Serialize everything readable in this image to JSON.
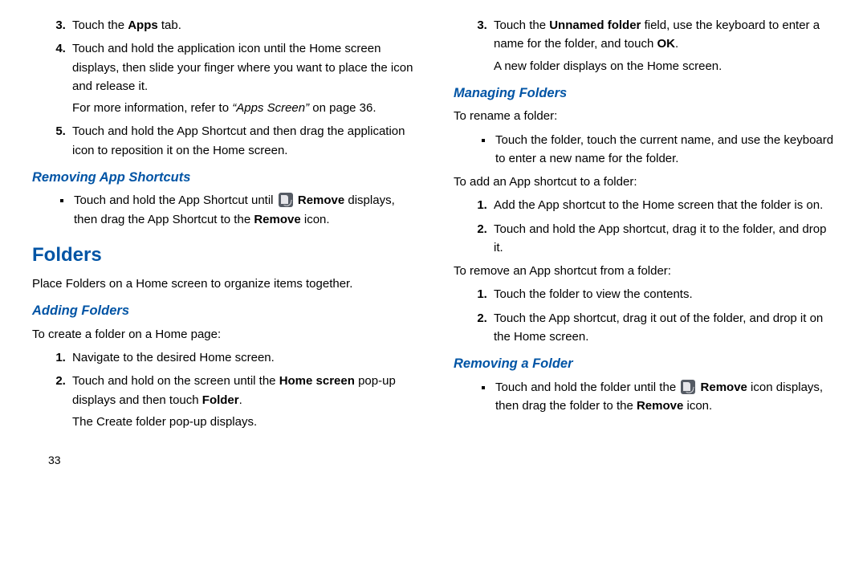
{
  "col1": {
    "steps_top": [
      {
        "num": "3.",
        "html": "Touch the <b>Apps</b> tab."
      },
      {
        "num": "4.",
        "html": "Touch and hold the application icon until the Home screen displays, then slide your finger where you want to place the icon and release it.",
        "after": "For more information, refer to <i>“Apps Screen”</i> on page 36."
      },
      {
        "num": "5.",
        "html": "Touch and hold the App Shortcut and then drag the application icon to reposition it on the Home screen."
      }
    ],
    "removing_shortcuts": {
      "title": "Removing App Shortcuts",
      "bullet": "Touch and hold the App Shortcut until [ICON] <b>Remove</b> displays, then drag the App Shortcut to the <b>Remove</b> icon."
    },
    "folders": {
      "title": "Folders",
      "intro": "Place Folders on a Home screen to organize items together."
    },
    "adding": {
      "title": "Adding Folders",
      "intro": "To create a folder on a Home page:",
      "steps": [
        {
          "num": "1.",
          "html": "Navigate to the desired Home screen."
        },
        {
          "num": "2.",
          "html": "Touch and hold on the screen until the <b>Home screen</b> pop-up displays and then touch <b>Folder</b>.",
          "after": "The Create folder pop-up displays."
        }
      ]
    }
  },
  "col2": {
    "step3": {
      "num": "3.",
      "html": "Touch the <b>Unnamed folder</b> field, use the keyboard to enter a name for the folder, and touch <b>OK</b>.",
      "after": "A new folder displays on the Home screen."
    },
    "managing": {
      "title": "Managing Folders",
      "rename_intro": "To rename a folder:",
      "rename_bullet": "Touch the folder, touch the current name, and use the keyboard to enter a new name for the folder.",
      "add_intro": "To add an App shortcut to a folder:",
      "add_steps": [
        {
          "num": "1.",
          "html": "Add the App shortcut to the Home screen that the folder is on."
        },
        {
          "num": "2.",
          "html": "Touch and hold the App shortcut, drag it to the folder, and drop it."
        }
      ],
      "remove_intro": "To remove an App shortcut from a folder:",
      "remove_steps": [
        {
          "num": "1.",
          "html": "Touch the folder to view the contents."
        },
        {
          "num": "2.",
          "html": "Touch the App shortcut, drag it out of the folder, and drop it on the Home screen."
        }
      ]
    },
    "removing_folder": {
      "title": "Removing a Folder",
      "bullet": "Touch and hold the folder until the [ICON] <b>Remove</b> icon displays, then drag the folder to the <b>Remove</b> icon."
    }
  },
  "page_number": "33"
}
